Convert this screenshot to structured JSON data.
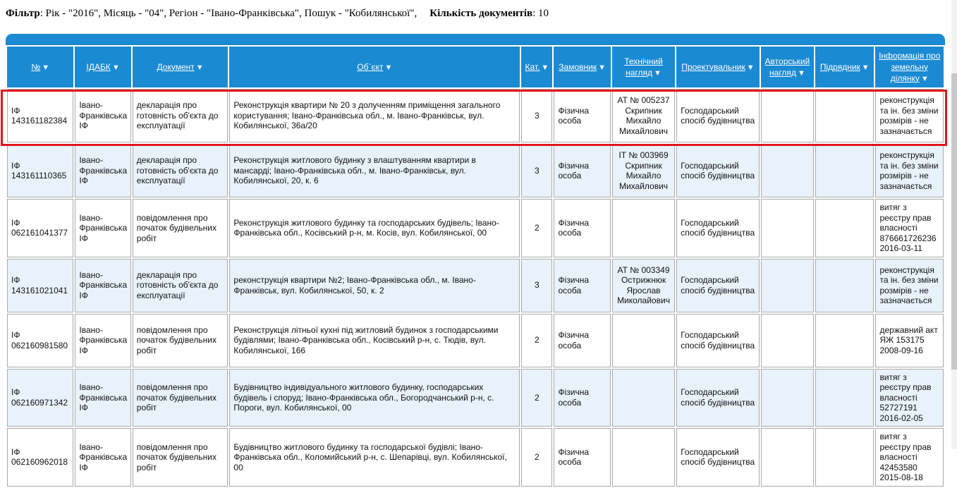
{
  "filter": {
    "label": "Фільтр",
    "text": ": Рік - \"2016\", Місяць - \"04\", Регіон - \"Івано-Франківська\", Пошук - \"Кобилянської\",",
    "count_label": "Кількість документів",
    "count_value": ": 10"
  },
  "table": {
    "headers": [
      {
        "label": "№",
        "arrow": "▼"
      },
      {
        "label": "ІДАБК",
        "arrow": "▼"
      },
      {
        "label": "Документ",
        "arrow": "▼"
      },
      {
        "label": "Об`єкт",
        "arrow": "▼"
      },
      {
        "label": "Кат.",
        "arrow": "▼"
      },
      {
        "label": "Замовник",
        "arrow": "▼"
      },
      {
        "label": "Технічний нагляд",
        "arrow": "▼"
      },
      {
        "label": "Проектувальник",
        "arrow": "▼"
      },
      {
        "label": "Авторський нагляд",
        "arrow": "▼"
      },
      {
        "label": "Підрядник",
        "arrow": "▼"
      },
      {
        "label": "Інформація про земельну ділянку",
        "arrow": "▼"
      }
    ],
    "rows": [
      {
        "num": "ІФ 143161182384",
        "idabk": "Івано-Франківська ІФ",
        "doc": "декларація про готовність об'єкта до експлуатації",
        "object": "Реконструкція квартири № 20 з долученням приміщення загального користування; Івано-Франківська обл., м. Івано-Франківськ, вул. Кобилянської, 36а/20",
        "cat": "3",
        "customer": "Фізична особа",
        "tech": "АТ № 005237 Скрипник Михайло Михайлович",
        "designer": "Господарський спосіб будівництва",
        "author": "",
        "contractor": "",
        "land": "реконструкція та ін. без зміни розмірів - не зазначається"
      },
      {
        "num": "ІФ 143161110365",
        "idabk": "Івано-Франківська ІФ",
        "doc": "декларація про готовність об'єкта до експлуатації",
        "object": "Реконструкція житлового будинку з влаштуванням квартири в мансарді; Івано-Франківська обл., м. Івано-Франківськ, вул. Кобилянської, 20, к. 6",
        "cat": "3",
        "customer": "Фізична особа",
        "tech": "ІТ № 003969 Скрипник Михайло Михайлович",
        "designer": "Господарський спосіб будівництва",
        "author": "",
        "contractor": "",
        "land": "реконструкція та ін. без зміни розмірів - не зазначається"
      },
      {
        "num": "ІФ 062161041377",
        "idabk": "Івано-Франківська ІФ",
        "doc": "повідомлення про початок будівельних робіт",
        "object": "Реконструкція житлового будинку та господарських будівель; Івано-Франківська обл., Косівський р-н, м. Косів, вул. Кобилянської, 00",
        "cat": "2",
        "customer": "Фізична особа",
        "tech": "",
        "designer": "Господарський спосіб будівництва",
        "author": "",
        "contractor": "",
        "land": "витяг з реєстру прав власності 876661726236 2016-03-11"
      },
      {
        "num": "ІФ 143161021041",
        "idabk": "Івано-Франківська ІФ",
        "doc": "декларація про готовність об'єкта до експлуатації",
        "object": "реконструкція квартири №2; Івано-Франківська обл., м. Івано-Франківськ, вул. Кобилянської, 50, к. 2",
        "cat": "3",
        "customer": "Фізична особа",
        "tech": "АТ № 003349 Острижнюк Ярослав Миколайович",
        "designer": "Господарський спосіб будівництва",
        "author": "",
        "contractor": "",
        "land": "реконструкція та ін. без зміни розмірів - не зазначається"
      },
      {
        "num": "ІФ 062160981580",
        "idabk": "Івано-Франківська ІФ",
        "doc": "повідомлення про початок будівельних робіт",
        "object": "Реконструкція літньої кухні під житловий будинок з господарськими будівлями; Івано-Франківська обл., Косівський р-н, с. Тюдів, вул. Кобилянської, 166",
        "cat": "2",
        "customer": "Фізична особа",
        "tech": "",
        "designer": "Господарський спосіб будівництва",
        "author": "",
        "contractor": "",
        "land": "державний акт ЯЖ 153175 2008-09-16"
      },
      {
        "num": "ІФ 062160971342",
        "idabk": "Івано-Франківська ІФ",
        "doc": "повідомлення про початок будівельних робіт",
        "object": "Будівництво індивідуального житлового будинку, господарських будівель і споруд; Івано-Франківська обл., Богородчанський р-н, с. Пороги, вул. Кобилянської, 00",
        "cat": "2",
        "customer": "Фізична особа",
        "tech": "",
        "designer": "Господарський спосіб будівництва",
        "author": "",
        "contractor": "",
        "land": "витяг з реєстру прав власності 52727191 2016-02-05"
      },
      {
        "num": "ІФ 062160962018",
        "idabk": "Івано-Франківська ІФ",
        "doc": "повідомлення про початок будівельних робіт",
        "object": "Будівництво житлового будинку та господарської будівлі; Івано-Франківська обл., Коломийський р-н, с. Шепарівці, вул. Кобилянської, 00",
        "cat": "2",
        "customer": "Фізична особа",
        "tech": "",
        "designer": "Господарський спосіб будівництва",
        "author": "",
        "contractor": "",
        "land": "витяг з реєстру прав власності 42453580 2015-08-18"
      }
    ]
  },
  "colors": {
    "header_bg": "#1a8ad3",
    "row_alt_bg": "#e9f2fb",
    "highlight": "#e0161e"
  }
}
